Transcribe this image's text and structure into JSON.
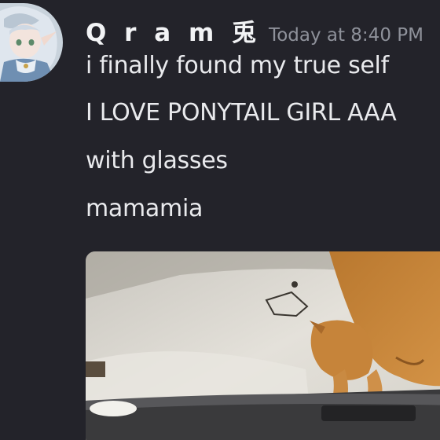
{
  "message": {
    "author": {
      "username": "Q r a m  兎",
      "avatar_icon": "anime-elf-avatar-icon"
    },
    "timestamp": "Today at 8:40 PM",
    "lines": [
      "i finally found my true self",
      "I LOVE PONYTAIL GIRL AAA",
      "with glasses",
      "mamamia"
    ],
    "attachment": {
      "type": "gif",
      "icon": "cat-gif-thumbnail"
    }
  },
  "colors": {
    "background": "#23232a",
    "username": "#f2f3f5",
    "timestamp": "#8e919a",
    "text": "#e9eaed"
  }
}
